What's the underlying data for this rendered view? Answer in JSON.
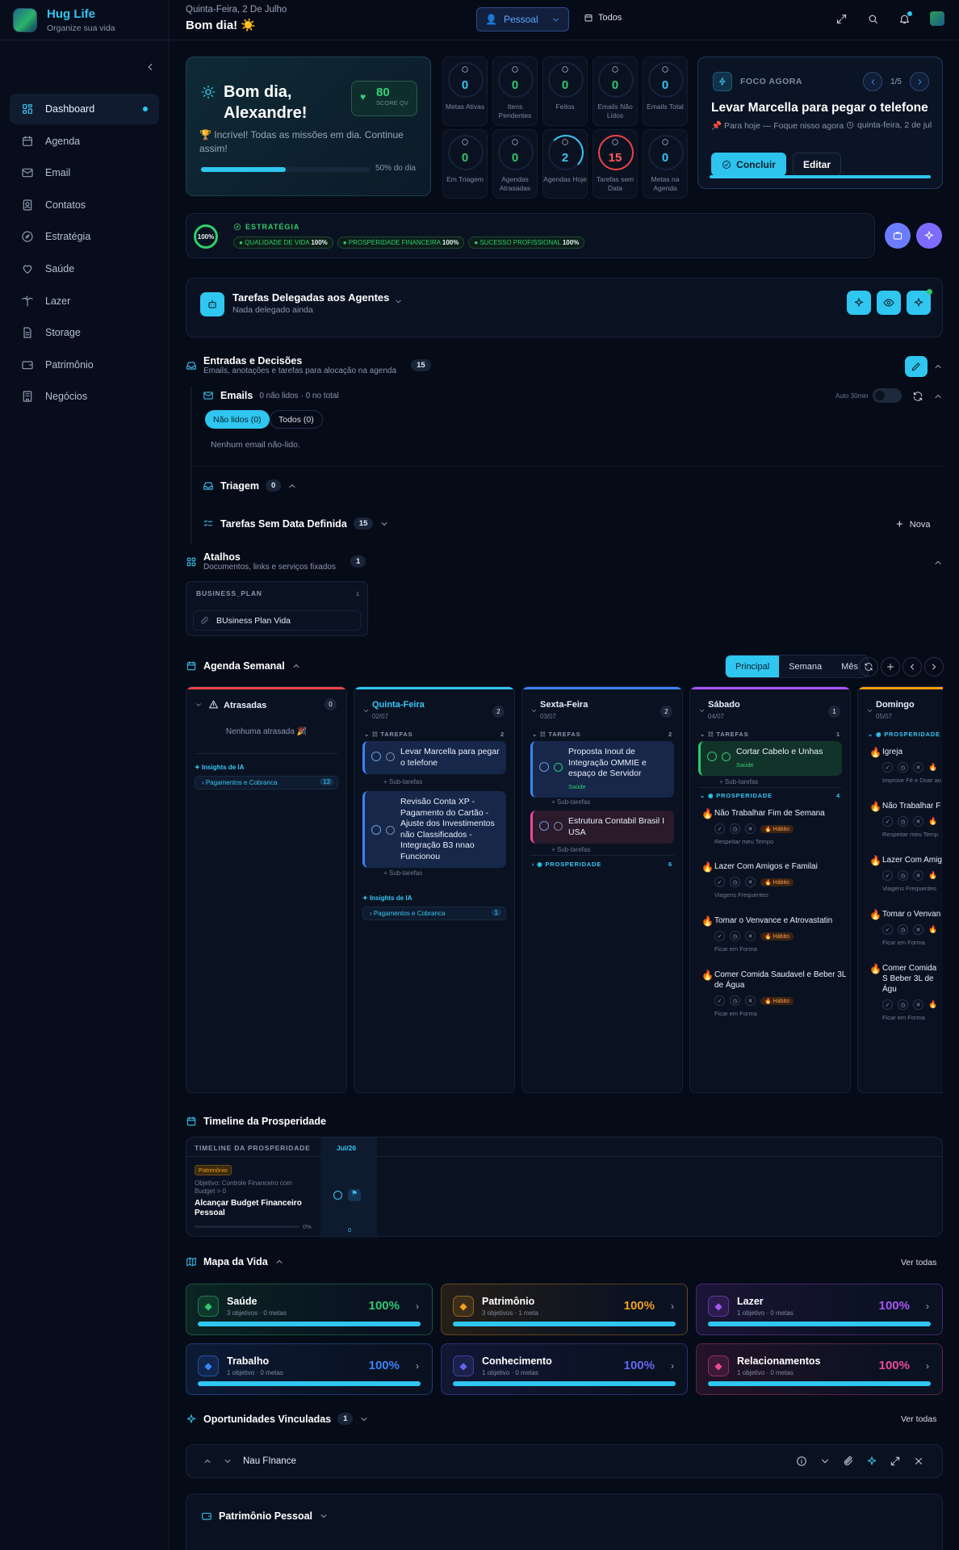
{
  "app": {
    "name": "Hug Life",
    "tagline": "Organize sua vida"
  },
  "sidebar": {
    "items": [
      {
        "label": "Dashboard",
        "icon": "grid-icon",
        "active": true
      },
      {
        "label": "Agenda",
        "icon": "calendar-icon"
      },
      {
        "label": "Email",
        "icon": "mail-icon"
      },
      {
        "label": "Contatos",
        "icon": "contacts-icon"
      },
      {
        "label": "Estratégia",
        "icon": "compass-icon"
      },
      {
        "label": "Saúde",
        "icon": "heart-icon"
      },
      {
        "label": "Lazer",
        "icon": "palm-icon"
      },
      {
        "label": "Storage",
        "icon": "file-icon"
      },
      {
        "label": "Patrimônio",
        "icon": "wallet-icon"
      },
      {
        "label": "Negócios",
        "icon": "building-icon"
      }
    ]
  },
  "header": {
    "date": "Quinta-Feira, 2 De Julho",
    "greeting": "Bom dia! ☀️",
    "profile": "Pessoal",
    "filter": "Todos"
  },
  "greeting_card": {
    "title": "Bom dia, Alexandre!",
    "score": "80",
    "score_label": "SCORE QV",
    "message": "🏆 Incrível! Todas as missões em dia. Continue assim!",
    "progress": 0.5,
    "progress_label": "50% do dia"
  },
  "stats": [
    {
      "value": "0",
      "label": "Metas Ativas",
      "color": "#38c6f2"
    },
    {
      "value": "0",
      "label": "Itens Pendentes",
      "color": "#30c96f"
    },
    {
      "value": "0",
      "label": "Feitos",
      "color": "#30c96f"
    },
    {
      "value": "0",
      "label": "Emails Não Lidos",
      "color": "#30c96f"
    },
    {
      "value": "0",
      "label": "Emails Total",
      "color": "#38c6f2"
    },
    {
      "value": "0",
      "label": "Em Triagem",
      "color": "#30c96f"
    },
    {
      "value": "0",
      "label": "Agendas Atrasadas",
      "color": "#30c96f"
    },
    {
      "value": "2",
      "label": "Agendas Hoje",
      "color": "#38c6f2"
    },
    {
      "value": "15",
      "label": "Tarefas sem Data",
      "color": "#ff5a5a"
    },
    {
      "value": "0",
      "label": "Metas na Agenda",
      "color": "#38c6f2"
    }
  ],
  "focus": {
    "tag": "FOCO AGORA",
    "pager": "1/5",
    "title": "Levar Marcella para pegar o telefone",
    "meta": "📌 Para hoje — Foque nisso agora",
    "date": "quinta-feira, 2 de jul",
    "primary": "Concluir",
    "secondary": "Editar"
  },
  "strategy": {
    "percent": "100%",
    "title": "ESTRATÉGIA",
    "pills": [
      {
        "label": "QUALIDADE DE VIDA",
        "value": "100%"
      },
      {
        "label": "PROSPERIDADE FINANCEIRA",
        "value": "100%"
      },
      {
        "label": "SUCESSO PROFISSIONAL",
        "value": "100%"
      }
    ]
  },
  "delegated": {
    "title": "Tarefas Delegadas aos Agentes",
    "subtitle": "Nada delegado ainda"
  },
  "inbox": {
    "title": "Entradas e Decisões",
    "subtitle": "Emails, anotações e tarefas para alocação na agenda",
    "count": "15",
    "emails": {
      "title": "Emails",
      "meta": "0 não lidos · 0 no total",
      "auto": "Auto 30min",
      "tab_unread": "Não lidos (0)",
      "tab_all": "Todos (0)",
      "empty": "Nenhum email não-lido."
    },
    "triage": {
      "title": "Triagem",
      "count": "0"
    },
    "nodate": {
      "title": "Tarefas Sem Data Definida",
      "count": "15",
      "new": "Nova"
    }
  },
  "shortcuts": {
    "title": "Atalhos",
    "subtitle": "Documentos, links e serviços fixados",
    "count": "1",
    "group": "BUSINESS_PLAN",
    "group_count": "1",
    "item": "BUsiness Plan Vida"
  },
  "agenda": {
    "title": "Agenda Semanal",
    "views": [
      "Principal",
      "Semana",
      "Mês"
    ],
    "overdue": {
      "title": "Atrasadas",
      "count": "0",
      "empty": "Nenhuma atrasada 🎉",
      "insights": "Insights de IA",
      "insight_item": "Pagamentos e Cobranca",
      "insight_count": "13"
    },
    "days": [
      {
        "name": "Quinta-Feira",
        "date": "02/07",
        "count": "2",
        "section": "TAREFAS",
        "section_count": "2",
        "tasks": [
          "Levar Marcella para pegar o telefone",
          "Revisão Conta XP - Pagamento do Cartão - Ajuste dos Investimentos não Classificados - Integração B3 nnao Funcionou"
        ],
        "subtasks": "+ Sub-tarefas",
        "insights": "Insights de IA",
        "insight_item": "Pagamentos e Cobranca",
        "insight_count": "1"
      },
      {
        "name": "Sexta-Feira",
        "date": "03/07",
        "count": "2",
        "section": "TAREFAS",
        "section_count": "2",
        "tasks": [
          "Proposta Inout de Integração OMMIE e espaço de Servidor",
          "Estrutura Contabil Brasil I USA"
        ],
        "task_tag": "Saúde",
        "subtasks": "+ Sub-tarefas",
        "prosperity": "PROSPERIDADE",
        "prosperity_count": "6"
      },
      {
        "name": "Sábado",
        "date": "04/07",
        "count": "1",
        "section": "TAREFAS",
        "section_count": "1",
        "tasks": [
          "Cortar Cabelo e Unhas"
        ],
        "task_tag": "Saúde",
        "subtasks": "+ Sub-tarefas",
        "prosperity": "PROSPERIDADE",
        "prosperity_count": "4",
        "habits": [
          {
            "name": "Não Trabalhar Fim de Semana",
            "badge": "🔥 Hábito",
            "sub": "Respeitar meu Tempo"
          },
          {
            "name": "Lazer Com Amigos e Familai",
            "badge": "🔥 Hábito",
            "sub": "Viagens Frequentes"
          },
          {
            "name": "Tomar o Venvance e Atrovastatin",
            "badge": "🔥 Hábito",
            "sub": "Ficar em Forma"
          },
          {
            "name": "Comer Comida Saudavel e Beber 3L de Água",
            "badge": "🔥 Hábito",
            "sub": "Ficar em Forma"
          }
        ]
      },
      {
        "name": "Domingo",
        "date": "05/07",
        "prosperity": "PROSPERIDADE",
        "habits": [
          {
            "name": "Igreja",
            "sub": "Improve Fé e Doar ao"
          },
          {
            "name": "Não Trabalhar F",
            "sub": "Respeitar meu Temp"
          },
          {
            "name": "Lazer Com Amig",
            "sub": "Viagens Frequentes"
          },
          {
            "name": "Tomar o Venvan",
            "sub": "Ficar em Forma"
          },
          {
            "name": "Comer Comida S Beber 3L de Águ",
            "sub": "Ficar em Forma"
          }
        ]
      }
    ]
  },
  "timeline": {
    "title": "Timeline da Prosperidade",
    "header": "TIMELINE DA PROSPERIDADE",
    "month": "Jul/26",
    "tag": "Patrimônio",
    "objective": "Objetivo: Controle Financeiro com Budget > 0",
    "goal": "Alcançar Budget Financeiro Pessoal",
    "pct": "0%",
    "axis": "0"
  },
  "life_map": {
    "title": "Mapa da Vida",
    "see_all": "Ver todas",
    "areas": [
      {
        "name": "Saúde",
        "sub": "3 objetivos · 0 metas",
        "pct": "100%",
        "color": "#30c96f"
      },
      {
        "name": "Patrimônio",
        "sub": "3 objetivos · 1 meta",
        "pct": "100%",
        "color": "#f0a020"
      },
      {
        "name": "Lazer",
        "sub": "1 objetivo · 0 metas",
        "pct": "100%",
        "color": "#a855f7"
      },
      {
        "name": "Trabalho",
        "sub": "1 objetivo · 0 metas",
        "pct": "100%",
        "color": "#3b82f6"
      },
      {
        "name": "Conhecimento",
        "sub": "1 objetivo · 0 metas",
        "pct": "100%",
        "color": "#6366f1"
      },
      {
        "name": "Relacionamentos",
        "sub": "1 objetivo · 0 metas",
        "pct": "100%",
        "color": "#ec4899"
      }
    ]
  },
  "opportunities": {
    "title": "Oportunidades Vinculadas",
    "count": "1",
    "see_all": "Ver todas",
    "item": "Nau FInance"
  },
  "patrimony": {
    "title": "Patrimônio Pessoal"
  }
}
